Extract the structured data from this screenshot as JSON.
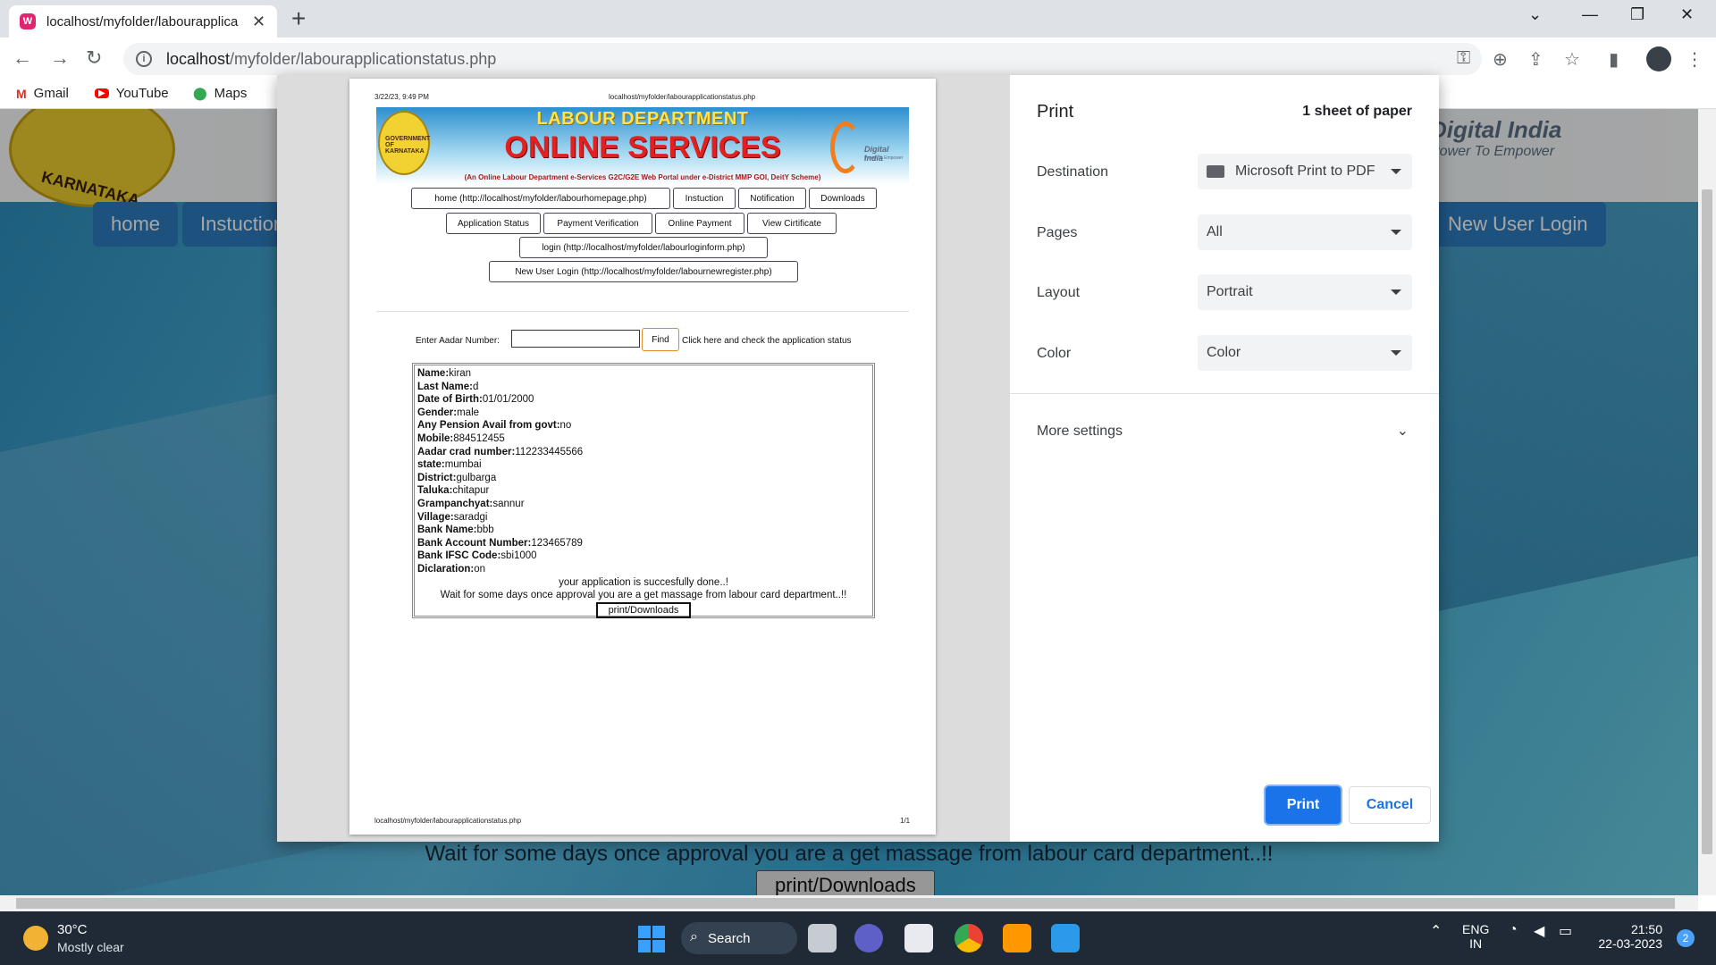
{
  "browser": {
    "tab_title": "localhost/myfolder/labourapplica",
    "url_host": "localhost",
    "url_path": "/myfolder/labourapplicationstatus.php",
    "bookmarks": [
      "Gmail",
      "YouTube",
      "Maps"
    ]
  },
  "background_page": {
    "nav": [
      "home",
      "Instuction",
      "New User Login"
    ],
    "message": "Wait for some days once approval you are a get massage from labour card department..!!",
    "button": "print/Downloads",
    "digital_india": "Digital India",
    "digital_india_sub": "Power To Empower",
    "state": "KARNATAKA"
  },
  "sheet": {
    "date": "3/22/23, 9:49 PM",
    "header_url": "localhost/myfolder/labourapplicationstatus.php",
    "banner_title": "LABOUR DEPARTMENT",
    "banner_main": "ONLINE SERVICES",
    "banner_sub": "(An Online Labour Department e-Services G2C/G2E Web Portal under e-District MMP GOI, DeitY Scheme)",
    "emblem_text": "GOVERNMENT OF KARNATAKA",
    "di_text": "Digital India",
    "di_sub": "Power To Empower",
    "nav": [
      "home (http://localhost/myfolder/labourhomepage.php)",
      "Instuction",
      "Notification",
      "Downloads",
      "Application Status",
      "Payment Verification",
      "Online Payment",
      "View Cirtificate",
      "login (http://localhost/myfolder/labourloginform.php)",
      "New User Login (http://localhost/myfolder/labournewregister.php)"
    ],
    "aadhar_label": "Enter Aadar Number:",
    "find_label": "Find",
    "find_hint": "Click here and check the application status",
    "fields": [
      {
        "label": "Name:",
        "value": "kiran"
      },
      {
        "label": "Last Name:",
        "value": "d"
      },
      {
        "label": "Date of Birth:",
        "value": "01/01/2000"
      },
      {
        "label": "Gender:",
        "value": "male"
      },
      {
        "label": "Any Pension Avail from govt:",
        "value": "no"
      },
      {
        "label": "Mobile:",
        "value": "884512455"
      },
      {
        "label": "Aadar crad number:",
        "value": "112233445566"
      },
      {
        "label": "state:",
        "value": "mumbai"
      },
      {
        "label": "District:",
        "value": "gulbarga"
      },
      {
        "label": "Taluka:",
        "value": "chitapur"
      },
      {
        "label": "Grampanchyat:",
        "value": "sannur"
      },
      {
        "label": "Village:",
        "value": "saradgi"
      },
      {
        "label": "Bank Name:",
        "value": "bbb"
      },
      {
        "label": "Bank Account Number:",
        "value": "123465789"
      },
      {
        "label": "Bank IFSC Code:",
        "value": "sbi1000"
      },
      {
        "label": "Diclaration:",
        "value": "on"
      }
    ],
    "success_msg": "your application is succesfully done..!",
    "wait_msg": "Wait for some days once approval you are a get massage from labour card department..!!",
    "print_btn": "print/Downloads",
    "footer_url": "localhost/myfolder/labourapplicationstatus.php",
    "page_num": "1/1"
  },
  "print_panel": {
    "title": "Print",
    "sheets": "1 sheet of paper",
    "destination_label": "Destination",
    "destination_value": "Microsoft Print to PDF",
    "pages_label": "Pages",
    "pages_value": "All",
    "layout_label": "Layout",
    "layout_value": "Portrait",
    "color_label": "Color",
    "color_value": "Color",
    "more_settings": "More settings",
    "print_btn": "Print",
    "cancel_btn": "Cancel"
  },
  "taskbar": {
    "temp": "30°C",
    "weather": "Mostly clear",
    "search": "Search",
    "lang1": "ENG",
    "lang2": "IN",
    "time": "21:50",
    "date": "22-03-2023",
    "notifications": "2"
  },
  "colors": {
    "accent": "#1a73e8",
    "page_nav": "#2e7fc2",
    "banner_red": "#e32020"
  }
}
